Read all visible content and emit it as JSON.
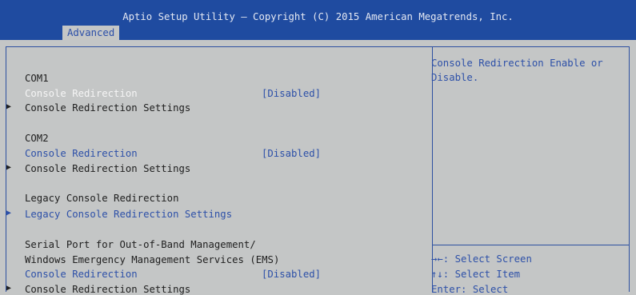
{
  "header": {
    "title": "Aptio Setup Utility – Copyright (C) 2015 American Megatrends, Inc.",
    "tab_advanced": "Advanced"
  },
  "menu": {
    "com1_heading": "COM1",
    "com1_redirection_label": "Console Redirection",
    "com1_redirection_value": "[Disabled]",
    "com1_settings_label": "Console Redirection Settings",
    "com2_heading": "COM2",
    "com2_redirection_label": "Console Redirection",
    "com2_redirection_value": "[Disabled]",
    "com2_settings_label": "Console Redirection Settings",
    "legacy_heading": "Legacy Console Redirection",
    "legacy_settings_label": "Legacy Console Redirection Settings",
    "ems_heading_line1": "Serial Port for Out-of-Band Management/",
    "ems_heading_line2": "Windows Emergency Management Services (EMS)",
    "ems_redirection_label": "Console Redirection",
    "ems_redirection_value": "[Disabled]",
    "ems_settings_label": "Console Redirection Settings"
  },
  "help": {
    "line1": "Console Redirection Enable or",
    "line2": "Disable.",
    "key1": "→←: Select Screen",
    "key2": "↑↓: Select Item",
    "key3": "Enter: Select"
  },
  "icons": {
    "submenu": "right-triangle"
  },
  "colors": {
    "header_bg": "#1f4ba0",
    "body_bg": "#c4c6c6",
    "selected_text": "#f5f5f5",
    "option_text": "#2d50a8"
  }
}
